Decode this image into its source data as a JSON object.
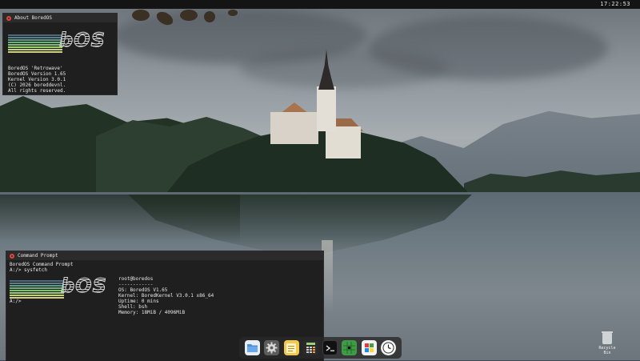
{
  "topbar": {
    "clock": "17:22:53"
  },
  "about_window": {
    "title": "About BoredOS",
    "lines": [
      "BoredOS 'Retrowave'",
      "BoredOS Version 1.65",
      "Kernel Version 3.0.1",
      "(C) 2026 boreddevnl.",
      "All rights reserved."
    ],
    "logo_text": "bOS"
  },
  "terminal_window": {
    "title": "Command Prompt",
    "header_lines": [
      "BoredOS Command Prompt",
      "A:/> sysfetch"
    ],
    "logo_text": "bOS",
    "fetch": {
      "host": "root@boredos",
      "separator": "------------",
      "os": "OS: BoredOS V1.65",
      "kernel": "Kernel: BoredKernel V3.0.1 x86_64",
      "uptime": "Uptime: 0 mins",
      "shell": "Shell: bsh",
      "memory": "Memory: 18MiB / 4096MiB"
    },
    "prompt": "A:/>"
  },
  "logo_stripe_colors": [
    "#4f6b7a",
    "#5a7f8a",
    "#5f9a8a",
    "#6fae7e",
    "#7fbf72",
    "#9fcf72",
    "#bfd27a",
    "#cfcf86"
  ],
  "dock": {
    "items": [
      {
        "name": "files",
        "icon": "folder-icon",
        "color": "#4d8fd6"
      },
      {
        "name": "settings",
        "icon": "gear-icon",
        "color": "#8a8a8a"
      },
      {
        "name": "notes",
        "icon": "notepad-icon",
        "color": "#f2c94c"
      },
      {
        "name": "calculator",
        "icon": "calculator-icon",
        "color": "#2a2a2a"
      },
      {
        "name": "terminal",
        "icon": "terminal-icon",
        "color": "#111111"
      },
      {
        "name": "minesweeper",
        "icon": "grid-icon",
        "color": "#4caf50"
      },
      {
        "name": "paint",
        "icon": "paint-icon",
        "color": "#f4f4f4"
      },
      {
        "name": "clock",
        "icon": "clock-icon",
        "color": "#f4f4f4"
      }
    ]
  },
  "desktop": {
    "recycle_bin_label": "Recycle\nBin"
  }
}
